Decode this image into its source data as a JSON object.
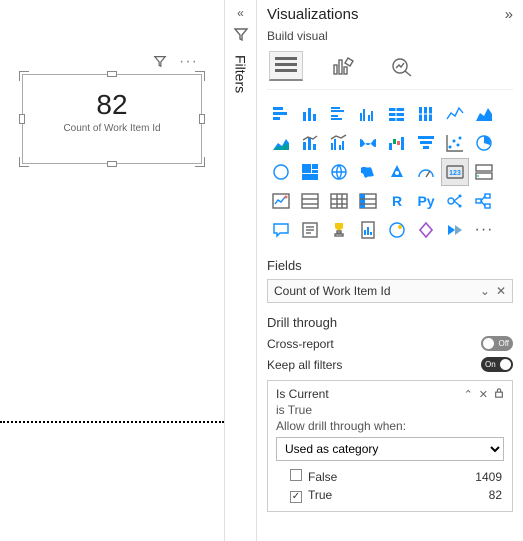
{
  "canvas": {
    "card": {
      "value": "82",
      "label": "Count of Work Item Id"
    }
  },
  "filters_tab": {
    "label": "Filters"
  },
  "viz": {
    "title": "Visualizations",
    "build_label": "Build visual",
    "fields_label": "Fields",
    "field_pill": "Count of Work Item Id",
    "drill_label": "Drill through",
    "cross_report_label": "Cross-report",
    "cross_report_state": "Off",
    "keep_filters_label": "Keep all filters",
    "keep_filters_state": "On",
    "drill_field": {
      "name": "Is Current",
      "summary": "is True",
      "allow_label": "Allow drill through when:",
      "mode": "Used as category",
      "options": [
        {
          "label": "False",
          "count": "1409",
          "checked": false
        },
        {
          "label": "True",
          "count": "82",
          "checked": true
        }
      ]
    }
  },
  "chart_data": {
    "type": "table",
    "title": "Is Current — Allow drill through when: Used as category",
    "categories": [
      "False",
      "True"
    ],
    "values": [
      1409,
      82
    ]
  }
}
